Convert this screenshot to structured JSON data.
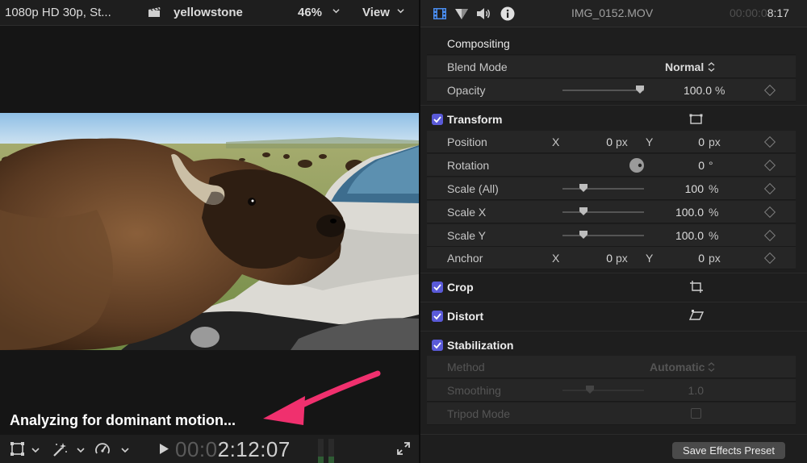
{
  "viewer": {
    "format": "1080p HD 30p, St...",
    "project": "yellowstone",
    "zoom": "46%",
    "view_menu": "View",
    "status": "Analyzing for dominant motion...",
    "timecode_dim": "00:0",
    "timecode": "2:12:07",
    "icons": [
      "transform-icon",
      "chevron-down-icon",
      "magic-wand-icon",
      "chevron-down-icon",
      "speedometer-icon",
      "chevron-down-icon",
      "play-icon",
      "audio-meter-icon",
      "fullscreen-icon",
      "clapperboard-icon"
    ]
  },
  "inspector": {
    "tabs": [
      "video-tab-icon",
      "color-tab-icon",
      "audio-tab-icon",
      "info-tab-icon"
    ],
    "clip_name": "IMG_0152.MOV",
    "duration_dim": "00:00:0",
    "duration": "8:17",
    "compositing": {
      "title": "Compositing",
      "blend_mode_label": "Blend Mode",
      "blend_mode_value": "Normal",
      "opacity_label": "Opacity",
      "opacity_value": "100.0",
      "opacity_unit": "%",
      "opacity_level": 1.0
    },
    "transform": {
      "title": "Transform",
      "enabled": true,
      "position_label": "Position",
      "x_axis": "X",
      "y_axis": "Y",
      "position_x": "0",
      "position_y": "0",
      "px_unit": "px",
      "rotation_label": "Rotation",
      "rotation_value": "0",
      "rotation_unit": "°",
      "scale_all_label": "Scale (All)",
      "scale_all_value": "100",
      "scale_x_label": "Scale X",
      "scale_x_value": "100.0",
      "scale_y_label": "Scale Y",
      "scale_y_value": "100.0",
      "percent_unit": "%",
      "anchor_label": "Anchor",
      "anchor_x": "0",
      "anchor_y": "0"
    },
    "crop": {
      "title": "Crop",
      "enabled": true
    },
    "distort": {
      "title": "Distort",
      "enabled": true
    },
    "stabilization": {
      "title": "Stabilization",
      "enabled": true,
      "method_label": "Method",
      "method_value": "Automatic",
      "smoothing_label": "Smoothing",
      "smoothing_value": "1.0",
      "tripod_label": "Tripod Mode"
    },
    "save_preset": "Save Effects Preset"
  },
  "colors": {
    "accent": "#5a5ad8",
    "annotation_arrow": "#f0306e",
    "background": "#1e1e1e"
  }
}
